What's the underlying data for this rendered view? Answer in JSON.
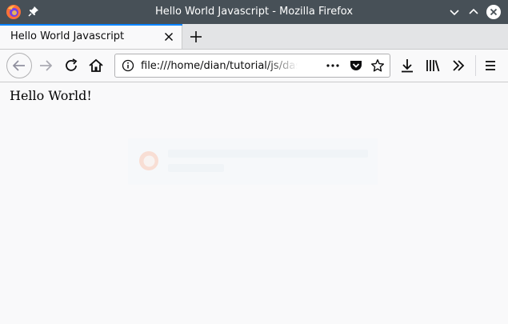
{
  "window": {
    "title": "Hello World Javascript - Mozilla Firefox"
  },
  "tab": {
    "label": "Hello World Javascript"
  },
  "urlbar": {
    "url": "file:///home/dian/tutorial/js/dasar/hello.html"
  },
  "page": {
    "greeting": "Hello World!"
  },
  "colors": {
    "titlebar": "#475057",
    "tab_highlight": "#0a84ff",
    "background": "#f9f9fa"
  },
  "icons": {
    "app": "firefox-logo-icon",
    "pin": "pin-icon",
    "minimize": "chevron-down-icon",
    "maximize": "chevron-up-icon",
    "close": "close-icon",
    "tab_close": "close-icon",
    "new_tab": "plus-icon",
    "back": "arrow-left-icon",
    "forward": "arrow-right-icon",
    "reload": "reload-icon",
    "home": "home-icon",
    "site_info": "info-icon",
    "page_actions": "more-dots-icon",
    "pocket": "pocket-icon",
    "bookmark": "star-icon",
    "downloads": "download-icon",
    "library": "library-icon",
    "overflow": "double-chevron-icon",
    "menu": "hamburger-menu-icon"
  }
}
